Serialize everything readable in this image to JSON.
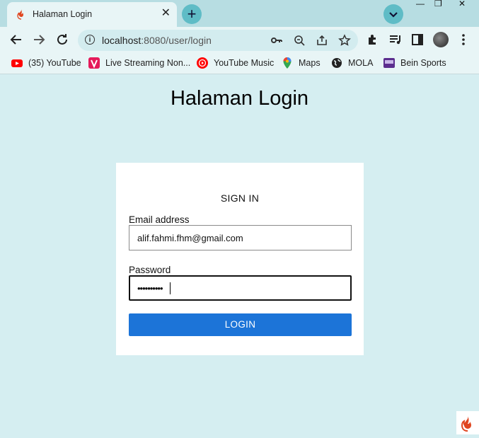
{
  "browser": {
    "tab_title": "Halaman Login",
    "tab_close": "✕",
    "new_tab": "+",
    "url_host": "localhost",
    "url_path": ":8080/user/login",
    "window_controls": [
      "—",
      "❐",
      "✕"
    ]
  },
  "bookmarks": [
    {
      "label": "(35) YouTube",
      "icon": "youtube-icon",
      "color": "#ff0000"
    },
    {
      "label": "Live Streaming Non...",
      "icon": "vidio-icon",
      "color": "#e51a5a"
    },
    {
      "label": "YouTube Music",
      "icon": "youtube-music-icon",
      "color": "#ff0000"
    },
    {
      "label": "Maps",
      "icon": "google-maps-icon",
      "color": "#34a853"
    },
    {
      "label": "MOLA",
      "icon": "globe-icon",
      "color": "#222222"
    },
    {
      "label": "Bein Sports",
      "icon": "bein-sports-icon",
      "color": "#5b2d8e"
    }
  ],
  "page": {
    "heading": "Halaman Login",
    "form": {
      "title": "SIGN IN",
      "email_label": "Email address",
      "email_value": "alif.fahmi.fhm@gmail.com",
      "password_label": "Password",
      "password_value": "••••••••••",
      "submit_label": "LOGIN"
    }
  },
  "colors": {
    "page_bg": "#d5eef1",
    "button": "#1c74d8",
    "tab_accent": "#5fbcc6"
  }
}
